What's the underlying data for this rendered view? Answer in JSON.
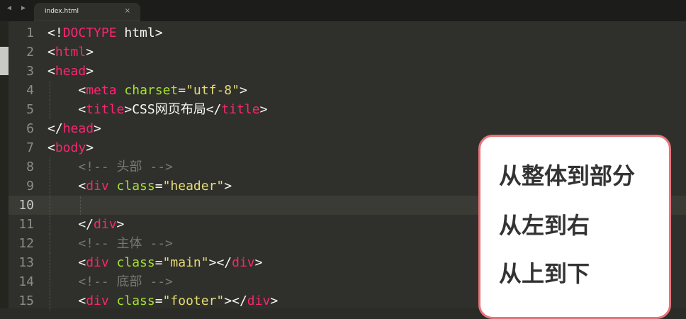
{
  "tab": {
    "filename": "index.html",
    "close": "×",
    "nav": "◀ ▶"
  },
  "editor": {
    "current_line": 10,
    "lines": [
      {
        "n": "1",
        "indent": 0,
        "tokens": [
          [
            "p",
            "<!"
          ],
          [
            "t",
            "DOCTYPE"
          ],
          [
            "p",
            " html>"
          ]
        ]
      },
      {
        "n": "2",
        "indent": 0,
        "tokens": [
          [
            "p",
            "<"
          ],
          [
            "t",
            "html"
          ],
          [
            "p",
            ">"
          ]
        ]
      },
      {
        "n": "3",
        "indent": 0,
        "tokens": [
          [
            "p",
            "<"
          ],
          [
            "t",
            "head"
          ],
          [
            "p",
            ">"
          ]
        ]
      },
      {
        "n": "4",
        "indent": 1,
        "tokens": [
          [
            "p",
            "    <"
          ],
          [
            "t",
            "meta"
          ],
          [
            "p",
            " "
          ],
          [
            "a",
            "charset"
          ],
          [
            "p",
            "="
          ],
          [
            "s",
            "\"utf-8\""
          ],
          [
            "p",
            ">"
          ]
        ]
      },
      {
        "n": "5",
        "indent": 1,
        "tokens": [
          [
            "p",
            "    <"
          ],
          [
            "t",
            "title"
          ],
          [
            "p",
            ">CSS网页布局</"
          ],
          [
            "t",
            "title"
          ],
          [
            "p",
            ">"
          ]
        ]
      },
      {
        "n": "6",
        "indent": 0,
        "tokens": [
          [
            "p",
            "</"
          ],
          [
            "t",
            "head"
          ],
          [
            "p",
            ">"
          ]
        ]
      },
      {
        "n": "7",
        "indent": 0,
        "tokens": [
          [
            "p",
            "<"
          ],
          [
            "t",
            "body"
          ],
          [
            "p",
            ">"
          ]
        ]
      },
      {
        "n": "8",
        "indent": 1,
        "tokens": [
          [
            "c",
            "    <!-- 头部 -->"
          ]
        ]
      },
      {
        "n": "9",
        "indent": 1,
        "tokens": [
          [
            "p",
            "    <"
          ],
          [
            "t",
            "div"
          ],
          [
            "p",
            " "
          ],
          [
            "a",
            "class"
          ],
          [
            "p",
            "="
          ],
          [
            "s",
            "\"header\""
          ],
          [
            "p",
            ">"
          ]
        ]
      },
      {
        "n": "10",
        "indent": 2,
        "tokens": [
          [
            "cursor",
            ""
          ]
        ]
      },
      {
        "n": "11",
        "indent": 1,
        "tokens": [
          [
            "p",
            "    </"
          ],
          [
            "t",
            "div"
          ],
          [
            "p",
            ">"
          ]
        ]
      },
      {
        "n": "12",
        "indent": 1,
        "tokens": [
          [
            "c",
            "    <!-- 主体 -->"
          ]
        ]
      },
      {
        "n": "13",
        "indent": 1,
        "tokens": [
          [
            "p",
            "    <"
          ],
          [
            "t",
            "div"
          ],
          [
            "p",
            " "
          ],
          [
            "a",
            "class"
          ],
          [
            "p",
            "="
          ],
          [
            "s",
            "\"main\""
          ],
          [
            "p",
            "></"
          ],
          [
            "t",
            "div"
          ],
          [
            "p",
            ">"
          ]
        ]
      },
      {
        "n": "14",
        "indent": 1,
        "tokens": [
          [
            "c",
            "    <!-- 底部 -->"
          ]
        ]
      },
      {
        "n": "15",
        "indent": 1,
        "tokens": [
          [
            "p",
            "    <"
          ],
          [
            "t",
            "div"
          ],
          [
            "p",
            " "
          ],
          [
            "a",
            "class"
          ],
          [
            "p",
            "="
          ],
          [
            "s",
            "\"footer\""
          ],
          [
            "p",
            "></"
          ],
          [
            "t",
            "div"
          ],
          [
            "p",
            ">"
          ]
        ]
      }
    ]
  },
  "note": {
    "lines": [
      "从整体到部分",
      "从左到右",
      "从上到下"
    ],
    "border_color": "#e8737a"
  },
  "colors": {
    "tag": "#f92672",
    "attribute": "#a6e22e",
    "string": "#e6db74",
    "comment": "#77786f",
    "background": "#2f302b"
  }
}
